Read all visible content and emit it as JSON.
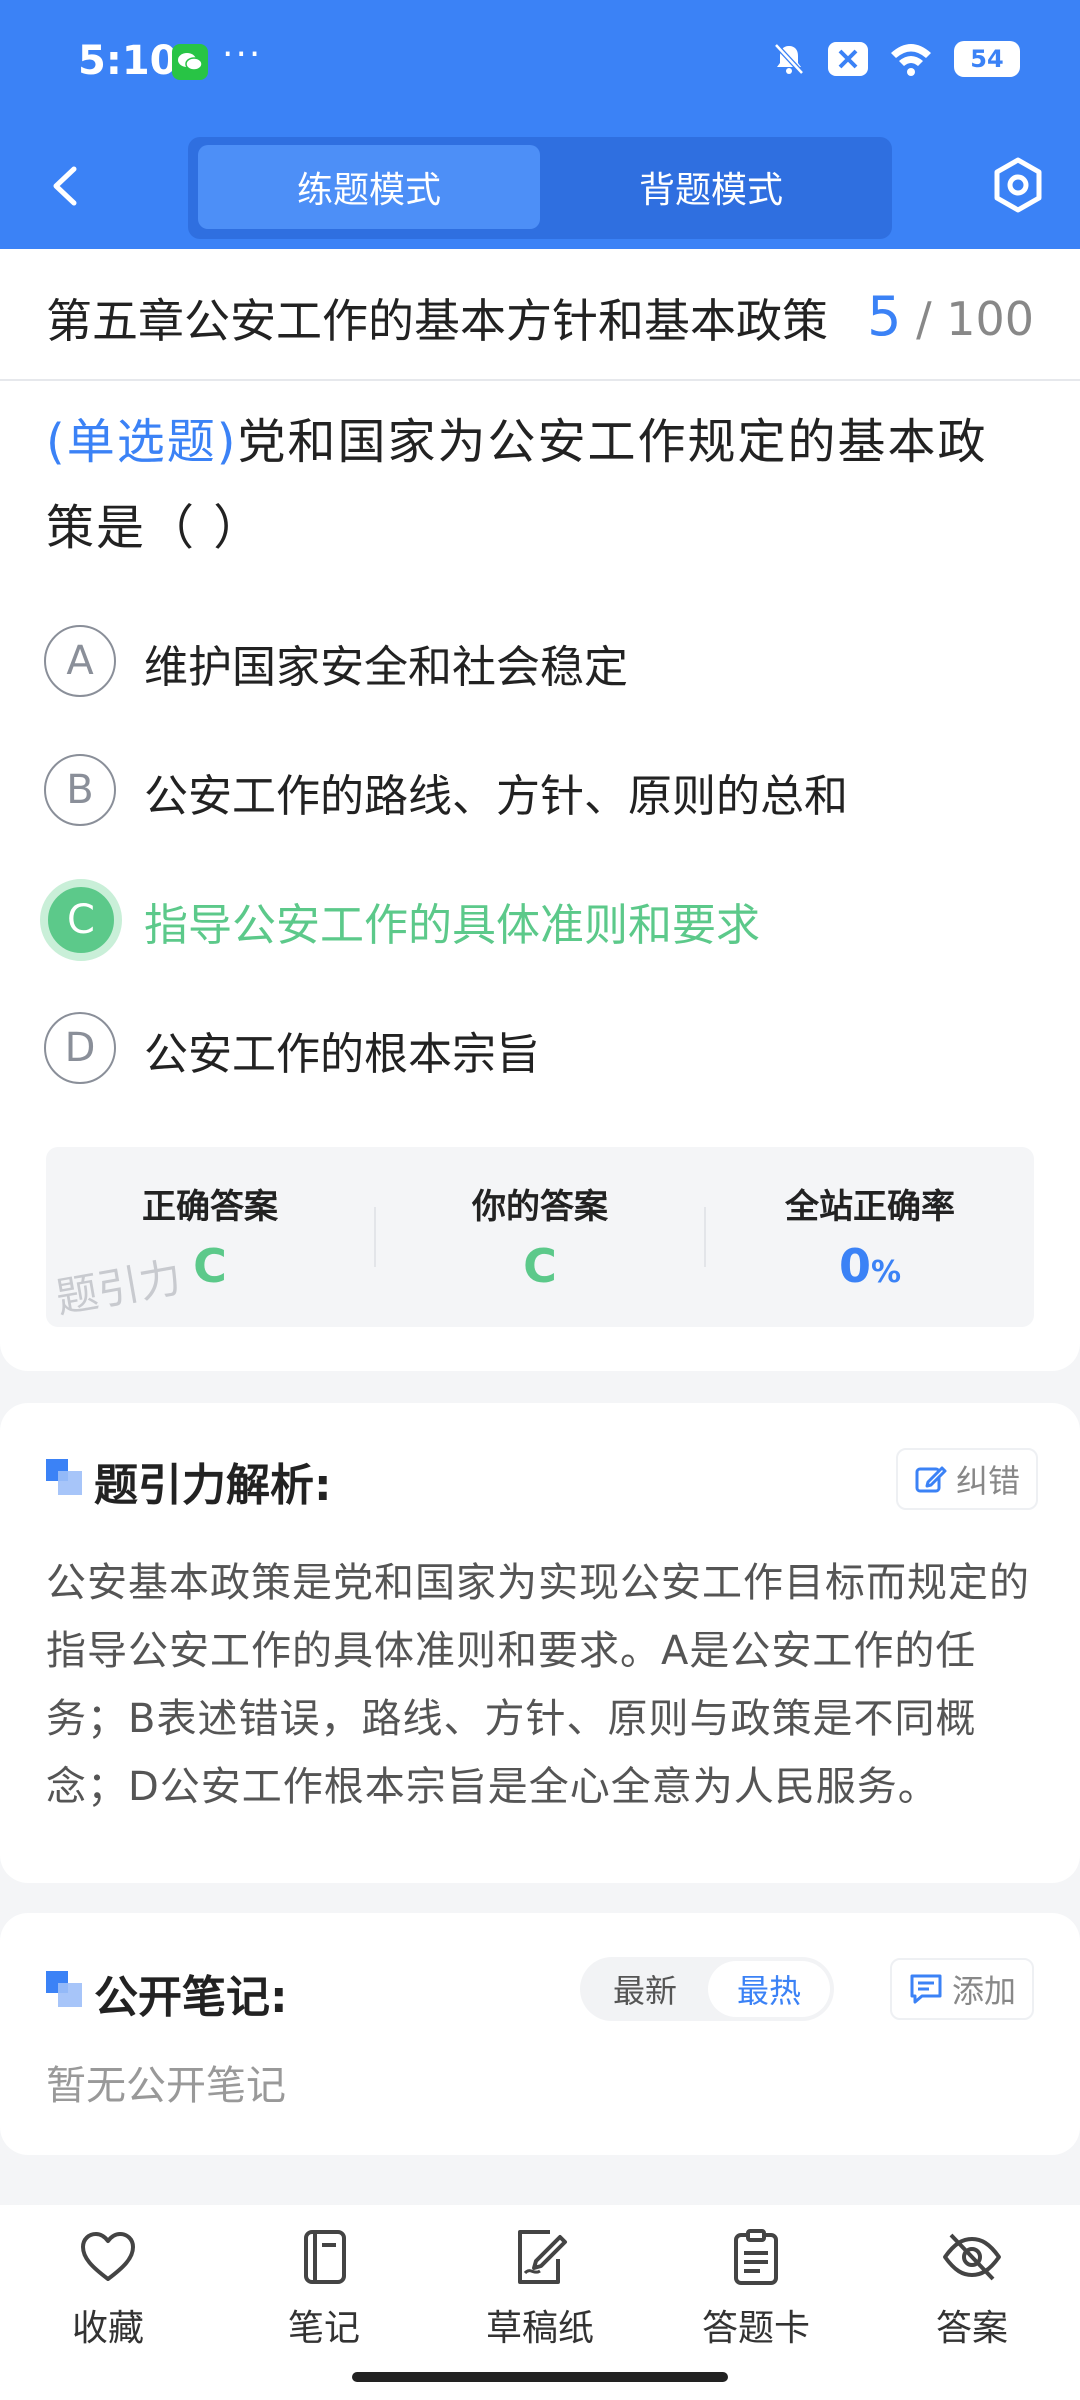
{
  "status_bar": {
    "time": "5:10",
    "more": "···",
    "battery": "54"
  },
  "nav": {
    "modes": [
      "练题模式",
      "背题模式"
    ],
    "active_mode_index": 0
  },
  "chapter": {
    "title": "第五章公安工作的基本方针和基本政策",
    "current": "5",
    "total": "/ 100"
  },
  "question": {
    "type_label": "(单选题)",
    "text": "党和国家为公安工作规定的基本政策是（        ）",
    "options": [
      {
        "letter": "A",
        "text": "维护国家安全和社会稳定"
      },
      {
        "letter": "B",
        "text": "公安工作的路线、方针、原则的总和"
      },
      {
        "letter": "C",
        "text": "指导公安工作的具体准则和要求"
      },
      {
        "letter": "D",
        "text": "公安工作的根本宗旨"
      }
    ],
    "selected": "C"
  },
  "answer_summary": {
    "correct_label": "正确答案",
    "correct_value": "C",
    "yours_label": "你的答案",
    "yours_value": "C",
    "rate_label": "全站正确率",
    "rate_value": "0",
    "rate_unit": "%",
    "watermark": "题引力"
  },
  "analysis": {
    "title": "题引力解析:",
    "report_label": "纠错",
    "text": "公安基本政策是党和国家为实现公安工作目标而规定的指导公安工作的具体准则和要求。A是公安工作的任务；B表述错误，路线、方针、原则与政策是不同概念；D公安工作根本宗旨是全心全意为人民服务。"
  },
  "notes": {
    "title": "公开笔记:",
    "sort_options": [
      "最新",
      "最热"
    ],
    "active_sort_index": 1,
    "add_label": "添加",
    "empty_text": "暂无公开笔记"
  },
  "toolbar": {
    "items": [
      {
        "label": "收藏",
        "icon": "heart-icon"
      },
      {
        "label": "笔记",
        "icon": "notebook-icon"
      },
      {
        "label": "草稿纸",
        "icon": "draft-icon"
      },
      {
        "label": "答题卡",
        "icon": "answer-card-icon"
      },
      {
        "label": "答案",
        "icon": "eye-off-icon"
      }
    ]
  },
  "colors": {
    "primary": "#3b82f6",
    "correct": "#5cc98a"
  }
}
